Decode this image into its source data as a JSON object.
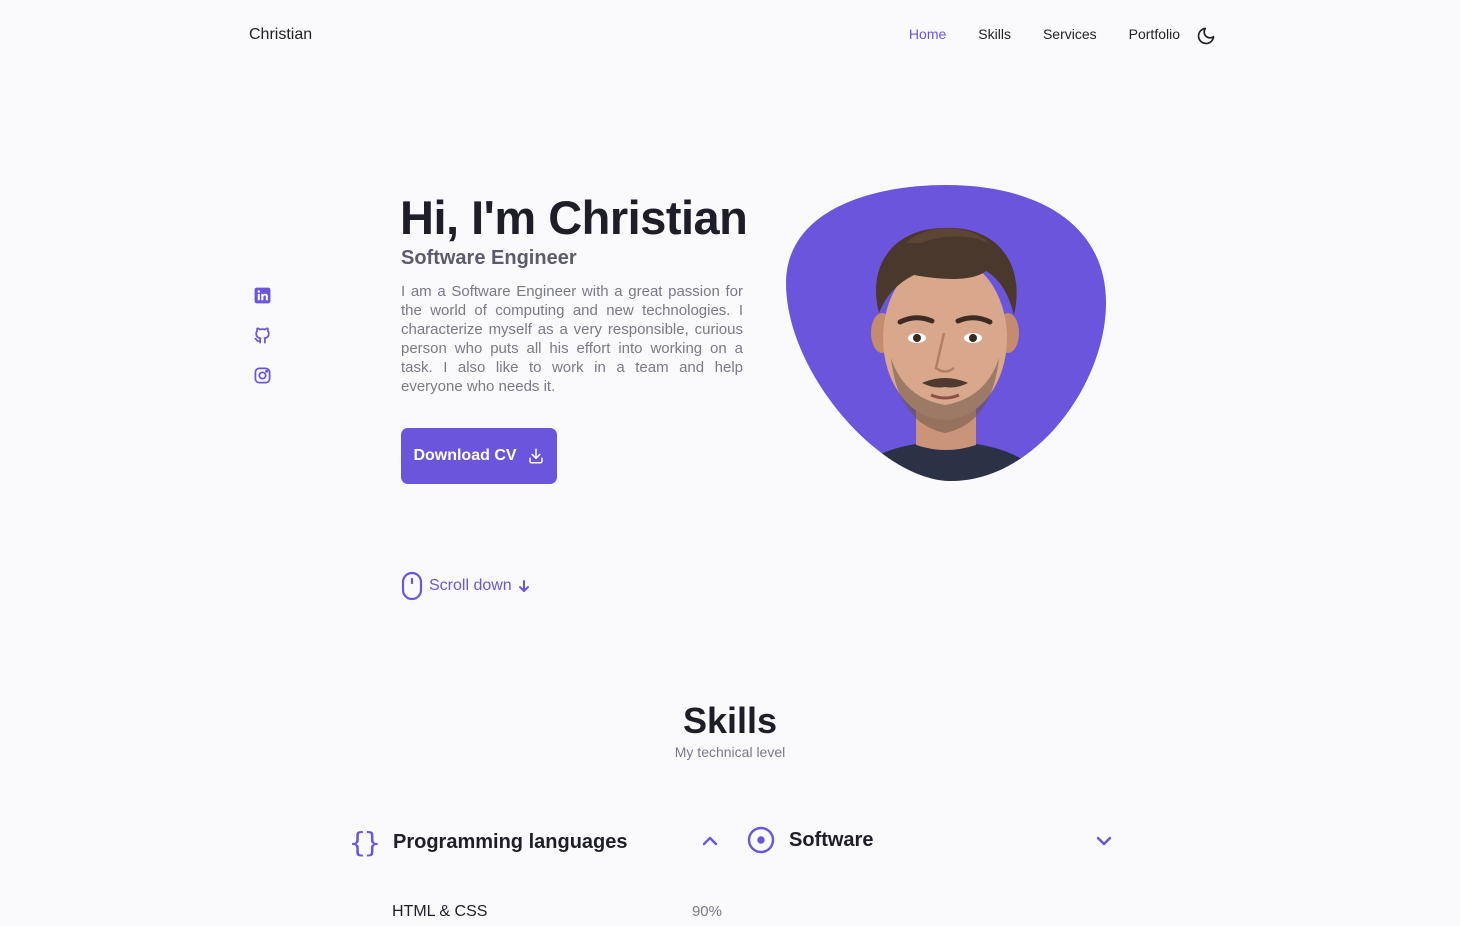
{
  "header": {
    "logo": "Christian",
    "nav": [
      {
        "label": "Home",
        "active": true
      },
      {
        "label": "Skills",
        "active": false
      },
      {
        "label": "Services",
        "active": false
      },
      {
        "label": "Portfolio",
        "active": false
      }
    ],
    "theme_icon": "moon-icon"
  },
  "social": [
    "linkedin-icon",
    "github-icon",
    "instagram-icon"
  ],
  "hero": {
    "title": "Hi, I'm Christian",
    "subtitle": "Software Engineer",
    "description": "I am a Software Engineer with a great passion for the world of computing and new technologies. I characterize myself as a very responsible, curious person who puts all his effort into working on a task. I also like to work in a team and help everyone who needs it.",
    "button_label": "Download CV",
    "button_icon": "download-icon"
  },
  "scroll": {
    "label": "Scroll down",
    "icon": "mouse-icon"
  },
  "skills": {
    "title": "Skills",
    "subtitle": "My technical level",
    "categories": [
      {
        "title": "Programming languages",
        "icon": "braces-icon",
        "expanded": true
      },
      {
        "title": "Software",
        "icon": "disc-icon",
        "expanded": false
      }
    ],
    "items": [
      {
        "name": "HTML & CSS",
        "percent": "90%"
      }
    ]
  },
  "colors": {
    "accent": "#6b55dc",
    "background": "#fafafd",
    "text": "#1e1e28"
  }
}
